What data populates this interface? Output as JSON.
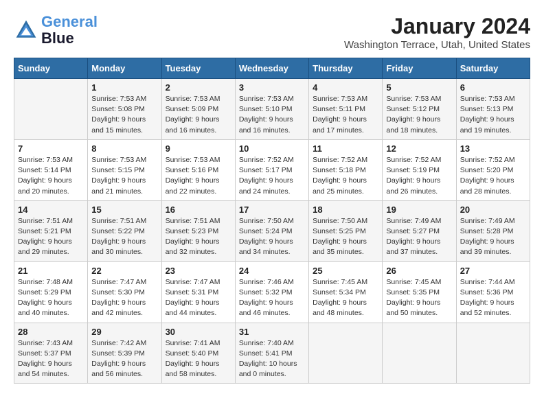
{
  "logo": {
    "line1": "General",
    "line2": "Blue"
  },
  "title": "January 2024",
  "location": "Washington Terrace, Utah, United States",
  "days_of_week": [
    "Sunday",
    "Monday",
    "Tuesday",
    "Wednesday",
    "Thursday",
    "Friday",
    "Saturday"
  ],
  "weeks": [
    [
      {
        "num": "",
        "sunrise": "",
        "sunset": "",
        "daylight": ""
      },
      {
        "num": "1",
        "sunrise": "Sunrise: 7:53 AM",
        "sunset": "Sunset: 5:08 PM",
        "daylight": "Daylight: 9 hours and 15 minutes."
      },
      {
        "num": "2",
        "sunrise": "Sunrise: 7:53 AM",
        "sunset": "Sunset: 5:09 PM",
        "daylight": "Daylight: 9 hours and 16 minutes."
      },
      {
        "num": "3",
        "sunrise": "Sunrise: 7:53 AM",
        "sunset": "Sunset: 5:10 PM",
        "daylight": "Daylight: 9 hours and 16 minutes."
      },
      {
        "num": "4",
        "sunrise": "Sunrise: 7:53 AM",
        "sunset": "Sunset: 5:11 PM",
        "daylight": "Daylight: 9 hours and 17 minutes."
      },
      {
        "num": "5",
        "sunrise": "Sunrise: 7:53 AM",
        "sunset": "Sunset: 5:12 PM",
        "daylight": "Daylight: 9 hours and 18 minutes."
      },
      {
        "num": "6",
        "sunrise": "Sunrise: 7:53 AM",
        "sunset": "Sunset: 5:13 PM",
        "daylight": "Daylight: 9 hours and 19 minutes."
      }
    ],
    [
      {
        "num": "7",
        "sunrise": "Sunrise: 7:53 AM",
        "sunset": "Sunset: 5:14 PM",
        "daylight": "Daylight: 9 hours and 20 minutes."
      },
      {
        "num": "8",
        "sunrise": "Sunrise: 7:53 AM",
        "sunset": "Sunset: 5:15 PM",
        "daylight": "Daylight: 9 hours and 21 minutes."
      },
      {
        "num": "9",
        "sunrise": "Sunrise: 7:53 AM",
        "sunset": "Sunset: 5:16 PM",
        "daylight": "Daylight: 9 hours and 22 minutes."
      },
      {
        "num": "10",
        "sunrise": "Sunrise: 7:52 AM",
        "sunset": "Sunset: 5:17 PM",
        "daylight": "Daylight: 9 hours and 24 minutes."
      },
      {
        "num": "11",
        "sunrise": "Sunrise: 7:52 AM",
        "sunset": "Sunset: 5:18 PM",
        "daylight": "Daylight: 9 hours and 25 minutes."
      },
      {
        "num": "12",
        "sunrise": "Sunrise: 7:52 AM",
        "sunset": "Sunset: 5:19 PM",
        "daylight": "Daylight: 9 hours and 26 minutes."
      },
      {
        "num": "13",
        "sunrise": "Sunrise: 7:52 AM",
        "sunset": "Sunset: 5:20 PM",
        "daylight": "Daylight: 9 hours and 28 minutes."
      }
    ],
    [
      {
        "num": "14",
        "sunrise": "Sunrise: 7:51 AM",
        "sunset": "Sunset: 5:21 PM",
        "daylight": "Daylight: 9 hours and 29 minutes."
      },
      {
        "num": "15",
        "sunrise": "Sunrise: 7:51 AM",
        "sunset": "Sunset: 5:22 PM",
        "daylight": "Daylight: 9 hours and 30 minutes."
      },
      {
        "num": "16",
        "sunrise": "Sunrise: 7:51 AM",
        "sunset": "Sunset: 5:23 PM",
        "daylight": "Daylight: 9 hours and 32 minutes."
      },
      {
        "num": "17",
        "sunrise": "Sunrise: 7:50 AM",
        "sunset": "Sunset: 5:24 PM",
        "daylight": "Daylight: 9 hours and 34 minutes."
      },
      {
        "num": "18",
        "sunrise": "Sunrise: 7:50 AM",
        "sunset": "Sunset: 5:25 PM",
        "daylight": "Daylight: 9 hours and 35 minutes."
      },
      {
        "num": "19",
        "sunrise": "Sunrise: 7:49 AM",
        "sunset": "Sunset: 5:27 PM",
        "daylight": "Daylight: 9 hours and 37 minutes."
      },
      {
        "num": "20",
        "sunrise": "Sunrise: 7:49 AM",
        "sunset": "Sunset: 5:28 PM",
        "daylight": "Daylight: 9 hours and 39 minutes."
      }
    ],
    [
      {
        "num": "21",
        "sunrise": "Sunrise: 7:48 AM",
        "sunset": "Sunset: 5:29 PM",
        "daylight": "Daylight: 9 hours and 40 minutes."
      },
      {
        "num": "22",
        "sunrise": "Sunrise: 7:47 AM",
        "sunset": "Sunset: 5:30 PM",
        "daylight": "Daylight: 9 hours and 42 minutes."
      },
      {
        "num": "23",
        "sunrise": "Sunrise: 7:47 AM",
        "sunset": "Sunset: 5:31 PM",
        "daylight": "Daylight: 9 hours and 44 minutes."
      },
      {
        "num": "24",
        "sunrise": "Sunrise: 7:46 AM",
        "sunset": "Sunset: 5:32 PM",
        "daylight": "Daylight: 9 hours and 46 minutes."
      },
      {
        "num": "25",
        "sunrise": "Sunrise: 7:45 AM",
        "sunset": "Sunset: 5:34 PM",
        "daylight": "Daylight: 9 hours and 48 minutes."
      },
      {
        "num": "26",
        "sunrise": "Sunrise: 7:45 AM",
        "sunset": "Sunset: 5:35 PM",
        "daylight": "Daylight: 9 hours and 50 minutes."
      },
      {
        "num": "27",
        "sunrise": "Sunrise: 7:44 AM",
        "sunset": "Sunset: 5:36 PM",
        "daylight": "Daylight: 9 hours and 52 minutes."
      }
    ],
    [
      {
        "num": "28",
        "sunrise": "Sunrise: 7:43 AM",
        "sunset": "Sunset: 5:37 PM",
        "daylight": "Daylight: 9 hours and 54 minutes."
      },
      {
        "num": "29",
        "sunrise": "Sunrise: 7:42 AM",
        "sunset": "Sunset: 5:39 PM",
        "daylight": "Daylight: 9 hours and 56 minutes."
      },
      {
        "num": "30",
        "sunrise": "Sunrise: 7:41 AM",
        "sunset": "Sunset: 5:40 PM",
        "daylight": "Daylight: 9 hours and 58 minutes."
      },
      {
        "num": "31",
        "sunrise": "Sunrise: 7:40 AM",
        "sunset": "Sunset: 5:41 PM",
        "daylight": "Daylight: 10 hours and 0 minutes."
      },
      {
        "num": "",
        "sunrise": "",
        "sunset": "",
        "daylight": ""
      },
      {
        "num": "",
        "sunrise": "",
        "sunset": "",
        "daylight": ""
      },
      {
        "num": "",
        "sunrise": "",
        "sunset": "",
        "daylight": ""
      }
    ]
  ]
}
